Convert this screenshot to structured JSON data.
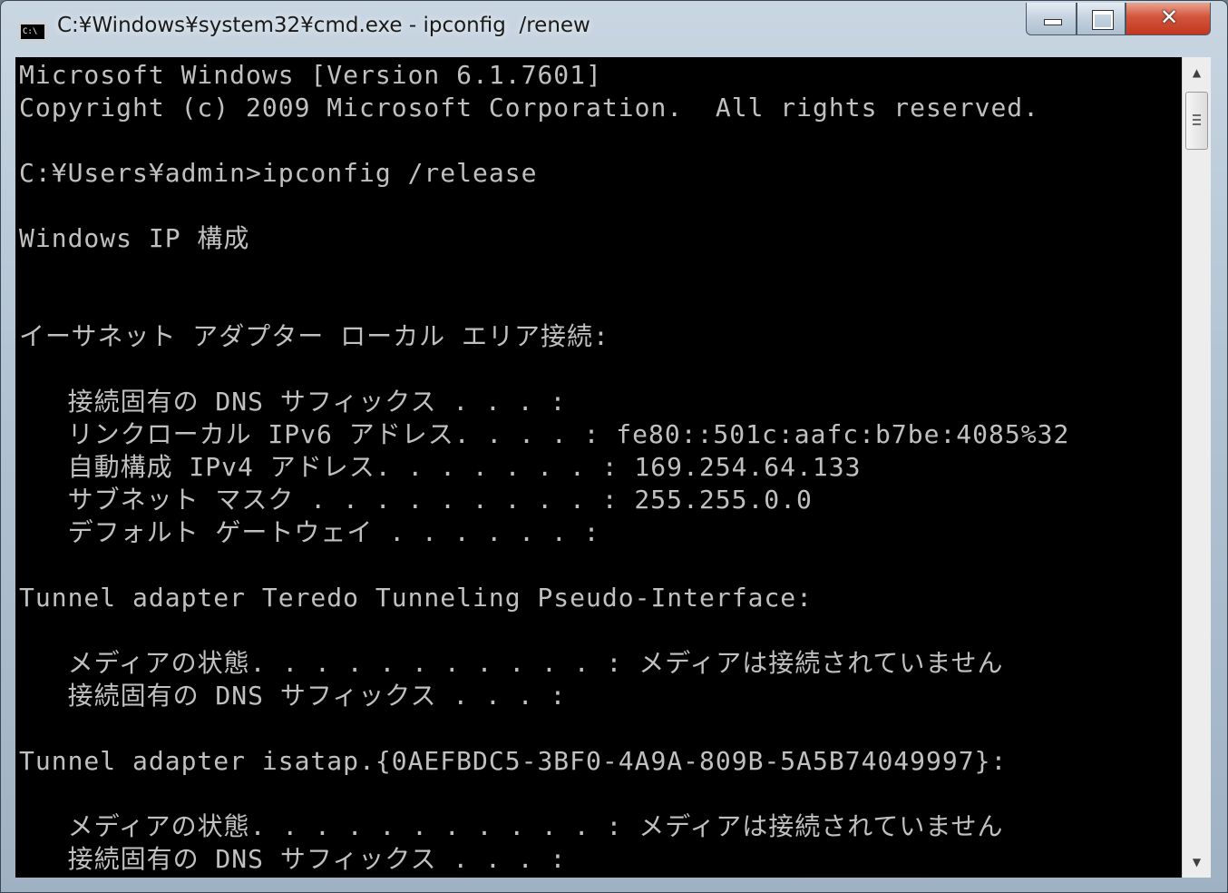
{
  "window": {
    "title": "C:¥Windows¥system32¥cmd.exe - ipconfig  /renew",
    "icon_label": "C:\\",
    "controls": {
      "minimize": "minimize-icon",
      "maximize": "maximize-icon",
      "close": "close-icon",
      "close_glyph": "✕"
    }
  },
  "console": {
    "lines": [
      "Microsoft Windows [Version 6.1.7601]",
      "Copyright (c) 2009 Microsoft Corporation.  All rights reserved.",
      "",
      "C:¥Users¥admin>ipconfig /release",
      "",
      "Windows IP 構成",
      "",
      "",
      "イーサネット アダプター ローカル エリア接続:",
      "",
      "   接続固有の DNS サフィックス . . . :",
      "   リンクローカル IPv6 アドレス. . . . : fe80::501c:aafc:b7be:4085%32",
      "   自動構成 IPv4 アドレス. . . . . . . : 169.254.64.133",
      "   サブネット マスク . . . . . . . . . : 255.255.0.0",
      "   デフォルト ゲートウェイ . . . . . . :",
      "",
      "Tunnel adapter Teredo Tunneling Pseudo-Interface:",
      "",
      "   メディアの状態. . . . . . . . . . . : メディアは接続されていません",
      "   接続固有の DNS サフィックス . . . :",
      "",
      "Tunnel adapter isatap.{0AEFBDC5-3BF0-4A9A-809B-5A5B74049997}:",
      "",
      "   メディアの状態. . . . . . . . . . . : メディアは接続されていません",
      "   接続固有の DNS サフィックス . . . :"
    ]
  },
  "scrollbar": {
    "up_arrow": "▲",
    "down_arrow": "▼"
  },
  "colors": {
    "console_background": "#000000",
    "console_text": "#c0c0c0",
    "close_button": "#c2381f"
  }
}
